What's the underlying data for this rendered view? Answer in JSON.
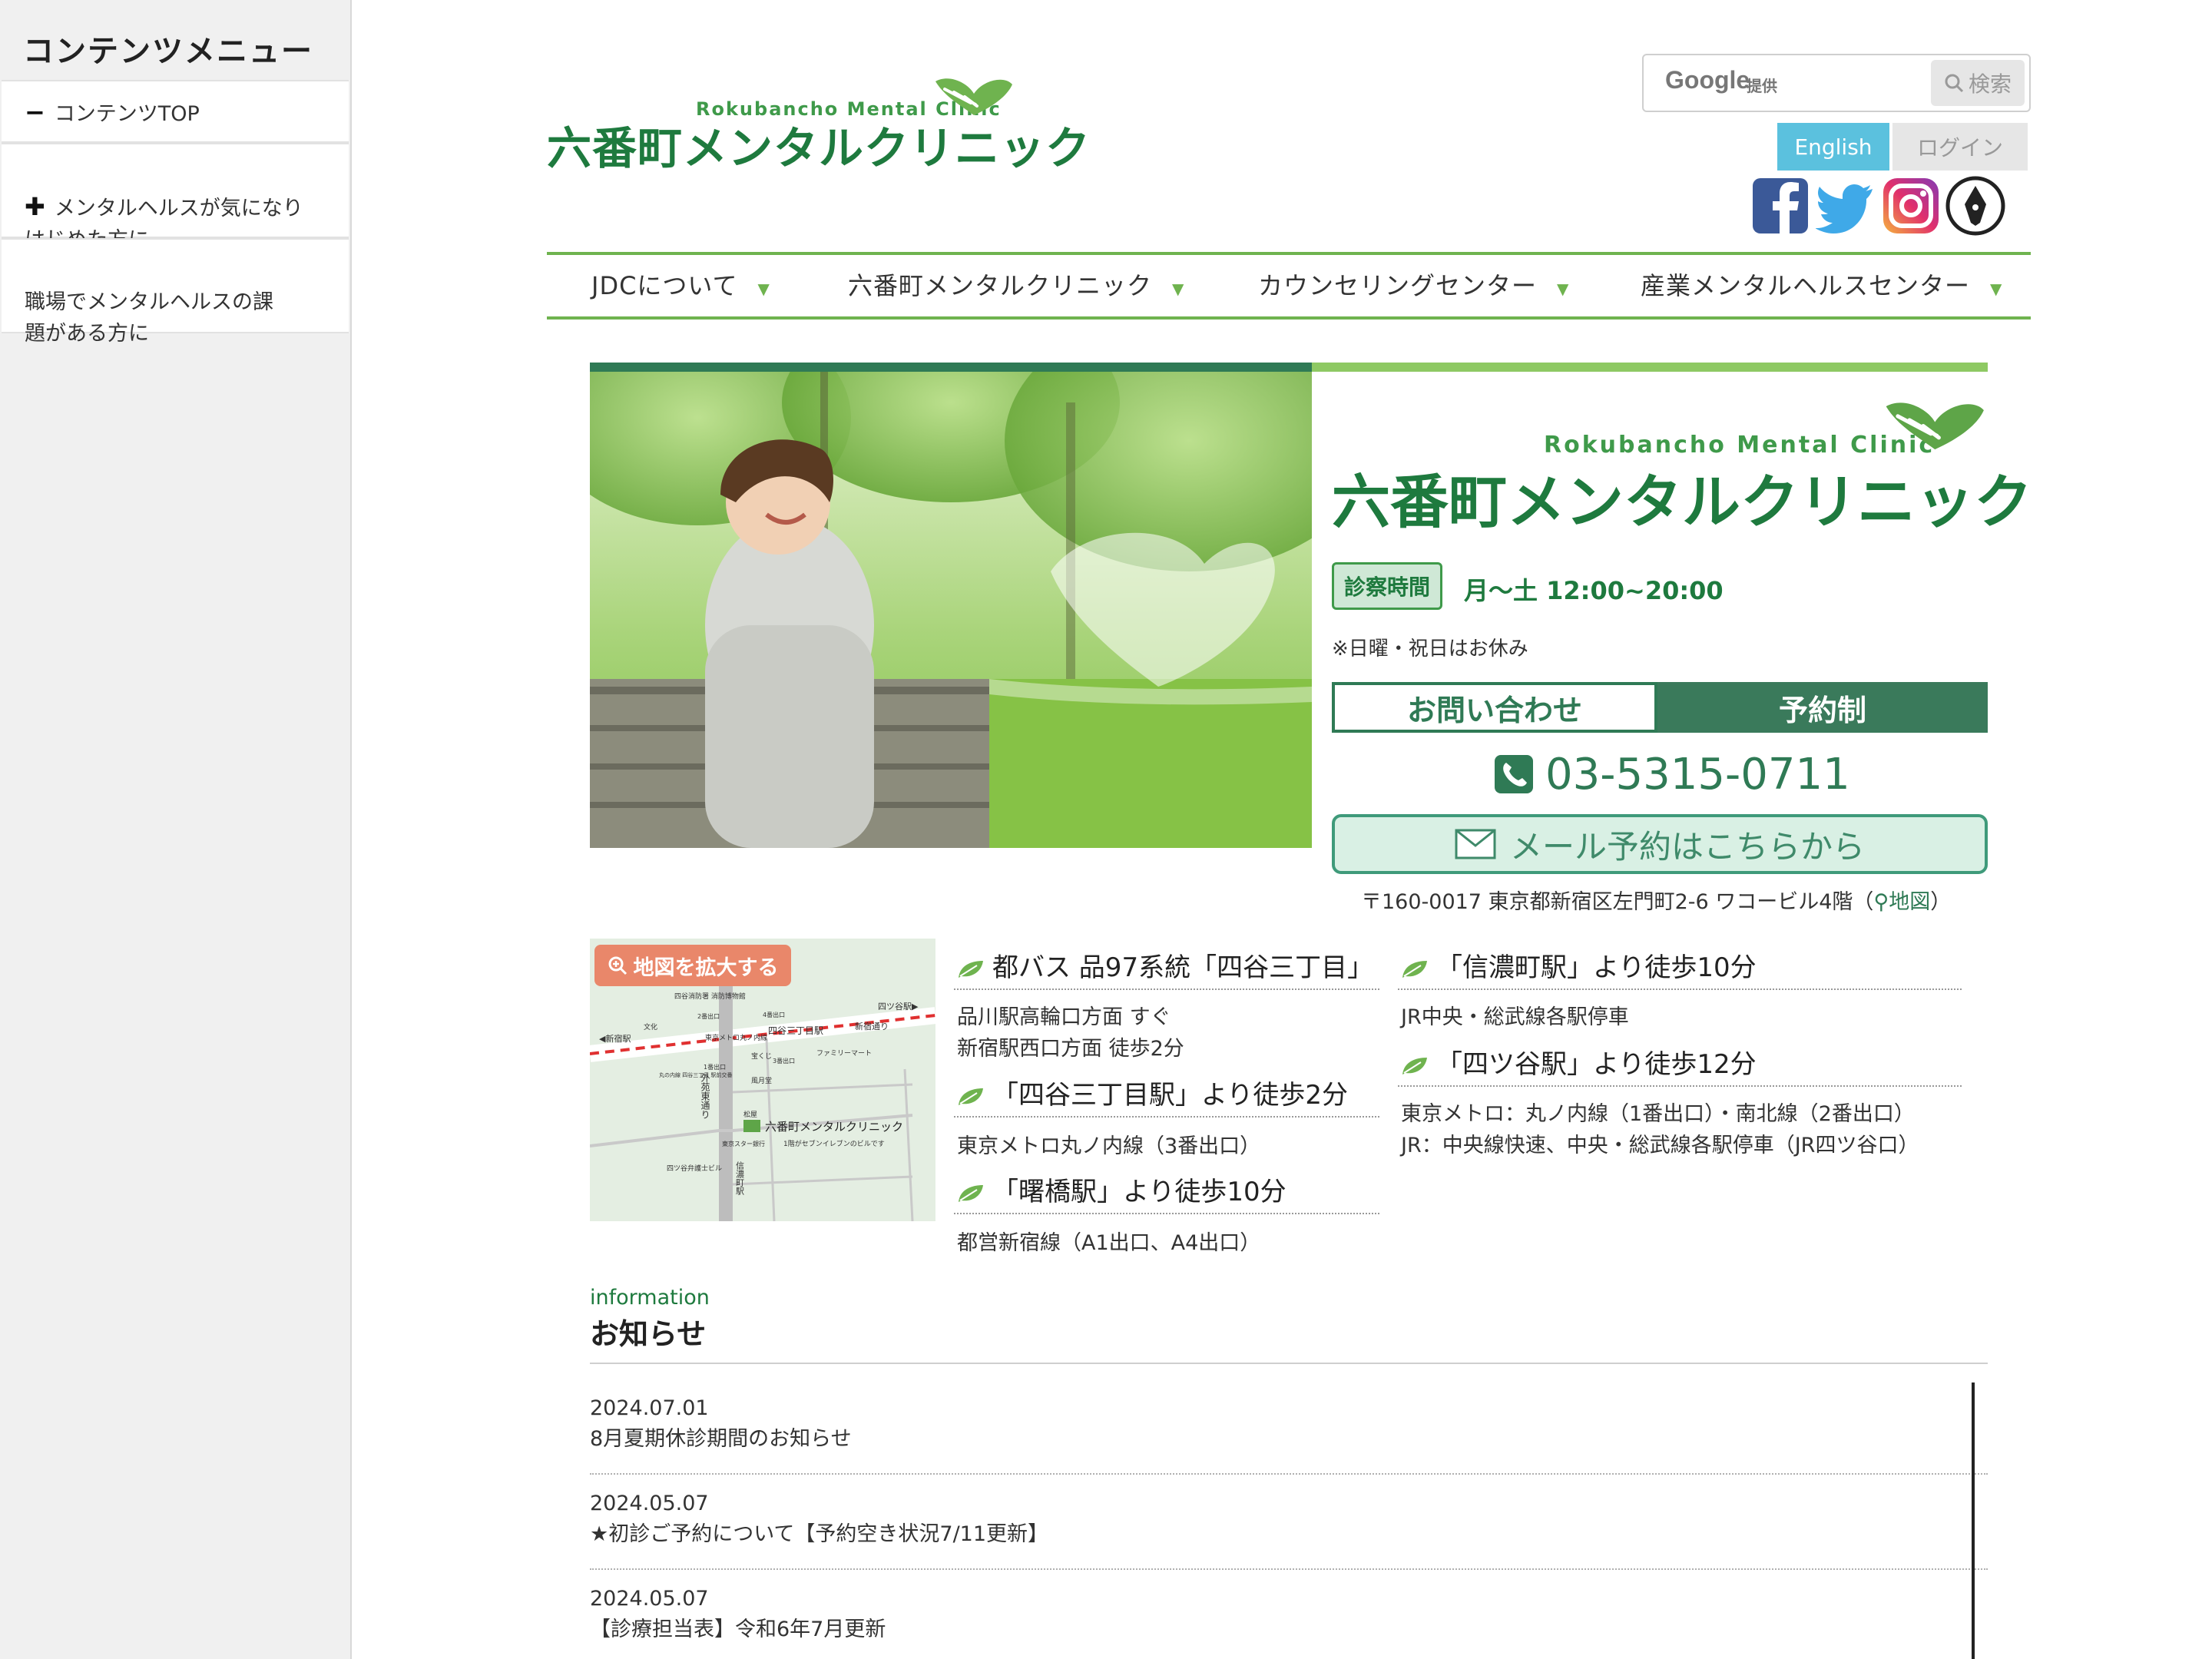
{
  "sidebar": {
    "title": "コンテンツメニュー",
    "items": [
      {
        "mark": "−",
        "label": "コンテンツTOP"
      },
      {
        "mark": "✚",
        "label": "メンタルヘルスが気になり\nはじめた方に"
      },
      {
        "mark": "",
        "label": "職場でメンタルヘルスの課\n題がある方に"
      }
    ]
  },
  "header": {
    "logo_sub": "Rokubancho Mental Clinic",
    "logo_main": "六番町メンタルクリニック",
    "search_brand": "Google",
    "search_provided": "提供",
    "search_button": "検索",
    "english": "English",
    "login": "ログイン",
    "social": [
      "facebook-icon",
      "twitter-icon",
      "instagram-icon",
      "note-icon"
    ]
  },
  "nav": [
    "JDCについて",
    "六番町メンタルクリニック",
    "カウンセリングセンター",
    "産業メンタルヘルスセンター"
  ],
  "hero": {
    "logo_sub": "Rokubancho Mental Clinic",
    "logo_main": "六番町メンタルクリニック",
    "hours_badge": "診察時間",
    "hours": "月〜土 12:00~20:00",
    "hours_note": "※日曜・祝日はお休み",
    "contact": "お問い合わせ",
    "reservation": "予約制",
    "phone": "03-5315-0711",
    "mail": "メール予約はこちらから",
    "address": "〒160-0017 東京都新宿区左門町2-6 ワコービル4階（",
    "map_link": "地図",
    "address_close": "）"
  },
  "access": {
    "map_zoom": "地図を拡大する",
    "map_labels": {
      "station": "四谷三丁目駅",
      "clinic": "六番町メンタルクリニック",
      "note": "1階がセブンイレブンのビルです",
      "line": "東京メトロ丸ノ内線",
      "shinjuku": "◀新宿駅",
      "yotsuya": "四ツ谷駅▶",
      "shinjuku_dori": "新宿通り",
      "gaien": "外苑東通り",
      "shinanomachi": "信濃町駅",
      "fire": "四谷消防署 消防博物館",
      "family": "ファミリーマート",
      "bunka": "文化",
      "takara": "宝くじ",
      "fuugetsu": "風月堂",
      "matsuya": "松屋",
      "bengoshi": "四ツ谷弁護士ビル",
      "exit1": "1番出口",
      "exit2": "2番出口",
      "exit3": "3番出口",
      "exit4": "4番出口",
      "sekine": "丸の内線 四谷三丁目 駅前交番",
      "bank": "東京スター銀行"
    },
    "bus_head": "都バス 品97系統「四谷三丁目」",
    "bus_text": "品川駅高輪口方面 すぐ\n新宿駅西口方面 徒歩2分",
    "yotsuya3_head": "「四谷三丁目駅」より徒歩2分",
    "yotsuya3_text": "東京メトロ丸ノ内線（3番出口）",
    "akebono_head": "「曙橋駅」より徒歩10分",
    "akebono_text": "都営新宿線（A1出口、A4出口）",
    "shinano_head": "「信濃町駅」より徒歩10分",
    "shinano_text": "JR中央・総武線各駅停車",
    "yotsuya_head": "「四ツ谷駅」より徒歩12分",
    "yotsuya_text": "東京メトロ：丸ノ内線（1番出口）・南北線（2番出口）\nJR：中央線快速、中央・総武線各駅停車（JR四ツ谷口）"
  },
  "news": {
    "label_en": "information",
    "title": "お知らせ",
    "items": [
      {
        "date": "2024.07.01",
        "text": "8月夏期休診期間のお知らせ"
      },
      {
        "date": "2024.05.07",
        "text": "★初診ご予約について【予約空き状況7/11更新】"
      },
      {
        "date": "2024.05.07",
        "text": "【診療担当表】令和6年7月更新"
      }
    ]
  },
  "colors": {
    "brand_green": "#1e7a3e",
    "accent_green": "#6fb34f",
    "dark_green": "#2f7a55",
    "english_blue": "#5bc1de",
    "zoom_orange": "#e9876a"
  }
}
